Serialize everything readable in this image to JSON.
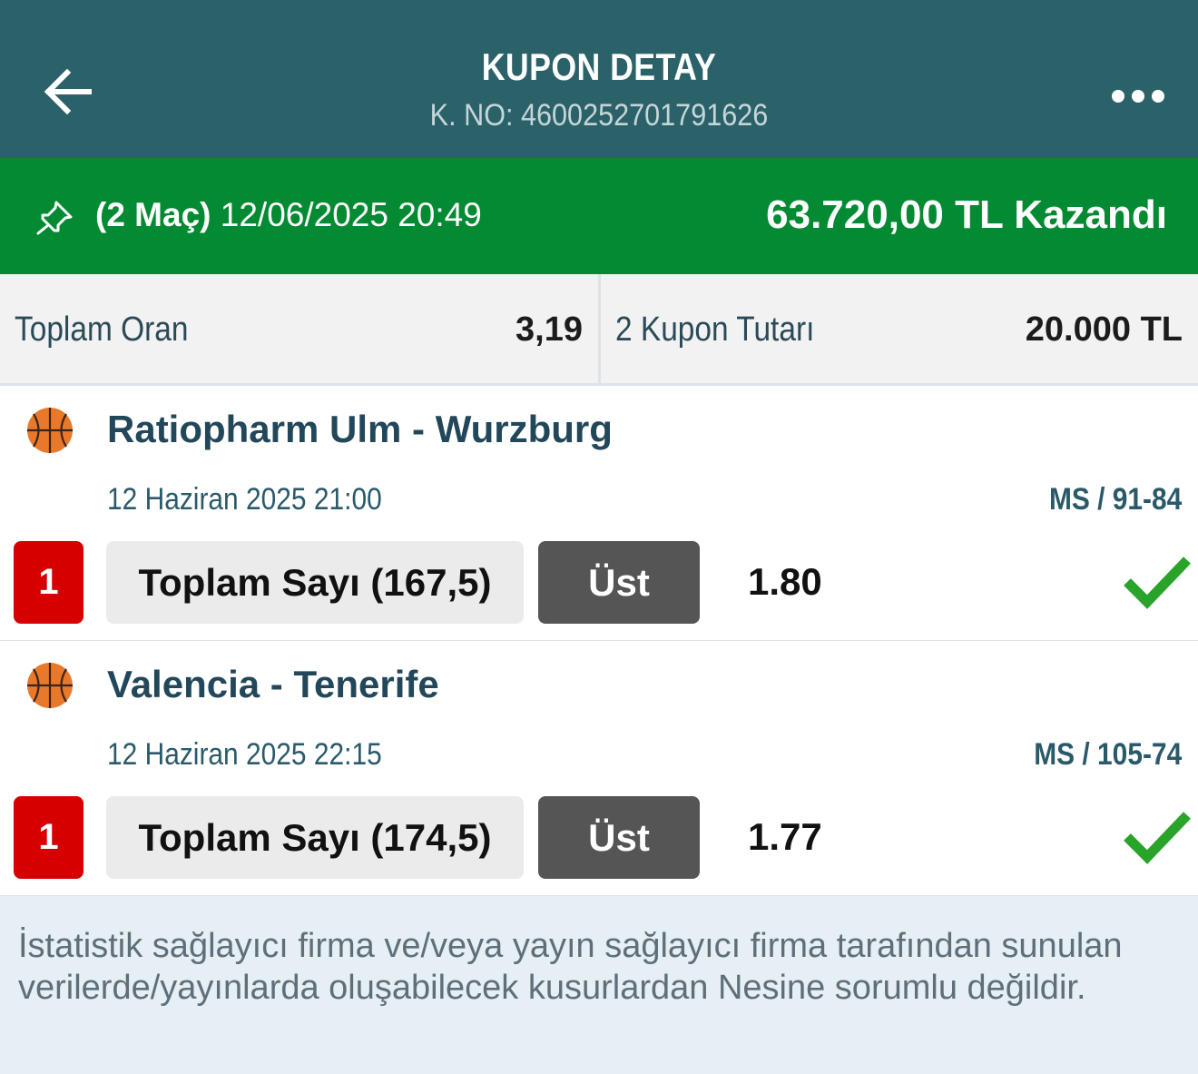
{
  "header": {
    "title": "KUPON DETAY",
    "coupon_no": "K. NO: 4600252701791626",
    "back_icon": "arrow-left-icon",
    "menu_icon": "more-horizontal-icon"
  },
  "banner": {
    "match_count": "(2 Maç)",
    "datetime": "12/06/2025 20:49",
    "winnings": "63.720,00 TL Kazandı",
    "pin_icon": "pin-icon",
    "color": "#048a32"
  },
  "summary": {
    "total_odds_label": "Toplam Oran",
    "total_odds_value": "3,19",
    "coupon_amount_label": "2 Kupon Tutarı",
    "coupon_amount_value": "20.000 TL"
  },
  "events": [
    {
      "sport_icon": "basketball-icon",
      "name": "Ratiopharm Ulm - Wurzburg",
      "date": "12 Haziran 2025 21:00",
      "score": "MS / 91-84",
      "pick_number": "1",
      "market": "Toplam Sayı (167,5)",
      "outcome": "Üst",
      "odds": "1.80",
      "status_icon": "checkmark-icon"
    },
    {
      "sport_icon": "basketball-icon",
      "name": "Valencia - Tenerife",
      "date": "12 Haziran 2025 22:15",
      "score": "MS / 105-74",
      "pick_number": "1",
      "market": "Toplam Sayı (174,5)",
      "outcome": "Üst",
      "odds": "1.77",
      "status_icon": "checkmark-icon"
    }
  ],
  "footer": {
    "disclaimer": "İstatistik sağlayıcı firma ve/veya yayın sağlayıcı firma tarafından sunulan verilerde/yayınlarda oluşabilecek kusurlardan Nesine sorumlu değildir."
  },
  "colors": {
    "header": "#2b6169",
    "win_green": "#048a32",
    "pick_red": "#d60000",
    "outcome_gray": "#555555",
    "check_green": "#2aa32a"
  }
}
